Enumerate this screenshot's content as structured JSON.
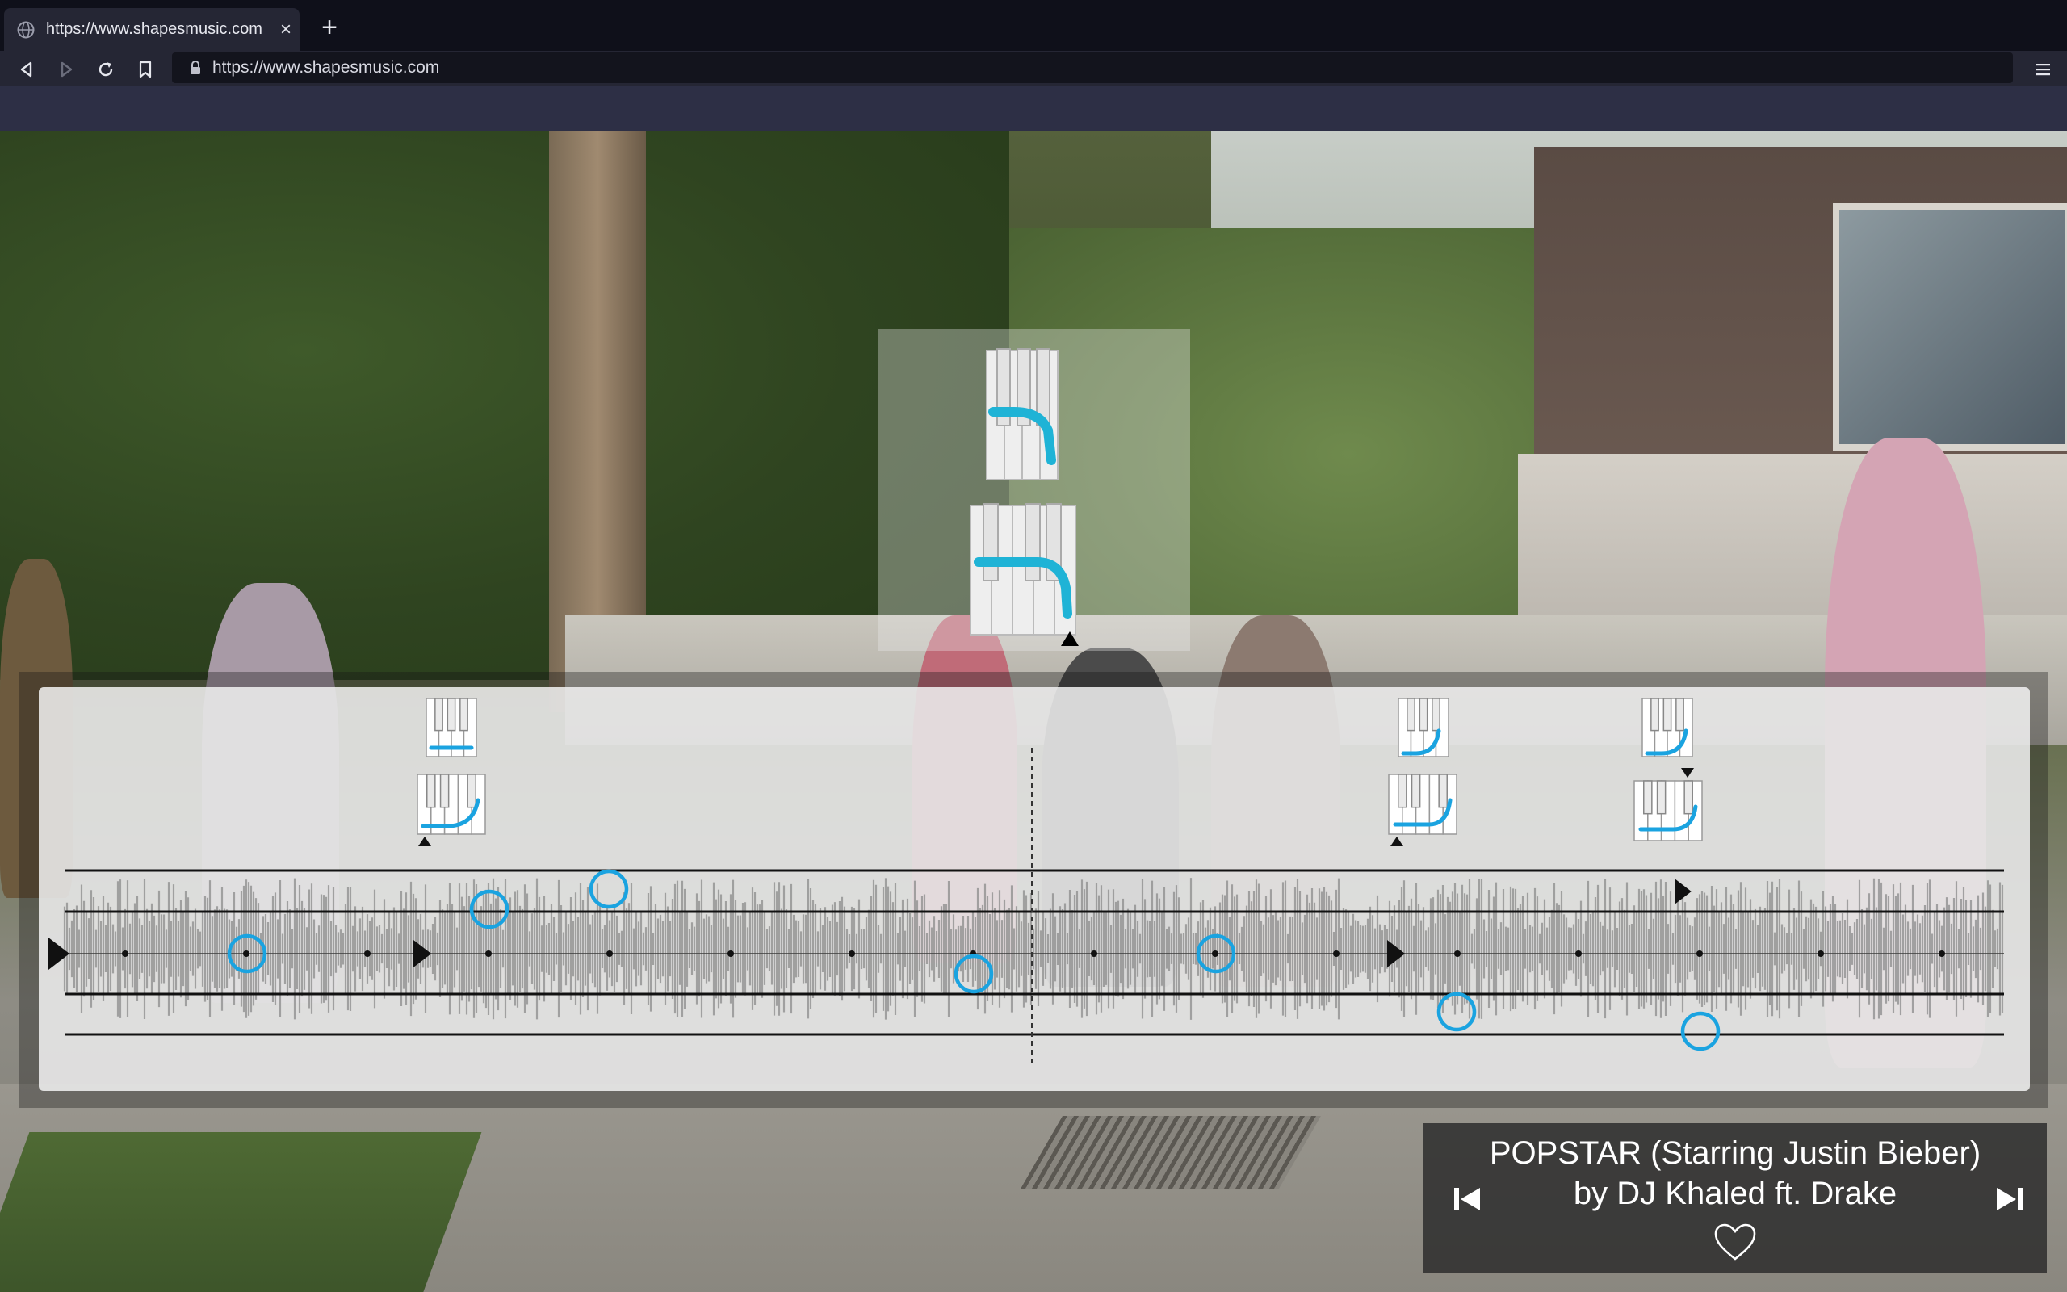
{
  "browser": {
    "tab_title": "https://www.shapesmusic.com",
    "tab_close_glyph": "×",
    "new_tab_glyph": "+",
    "url": "https://www.shapesmusic.com",
    "icons": [
      "globe-icon",
      "close-icon",
      "plus-icon",
      "back-icon",
      "forward-icon",
      "reload-icon",
      "bookmark-icon",
      "lock-icon",
      "menu-icon"
    ]
  },
  "player": {
    "song_title": "POPSTAR (Starring Justin Bieber)",
    "song_artist": "by DJ Khaled ft. Drake",
    "icons": [
      "skip-previous-icon",
      "skip-next-icon",
      "heart-icon"
    ]
  },
  "colors": {
    "accent": "#1aa3e0",
    "chrome_dark": "#0f101a",
    "chrome_toolbar": "#252634",
    "chrome_strip": "#2d2f45",
    "panel_light": "#f2f2f2",
    "panel_dark": "#2d2d2d"
  },
  "timeline": {
    "staff_lines": 5,
    "playhead": "dashed",
    "note_shape": "circle",
    "note_color": "#1aa3e0",
    "hand_shape_icons": 6
  }
}
